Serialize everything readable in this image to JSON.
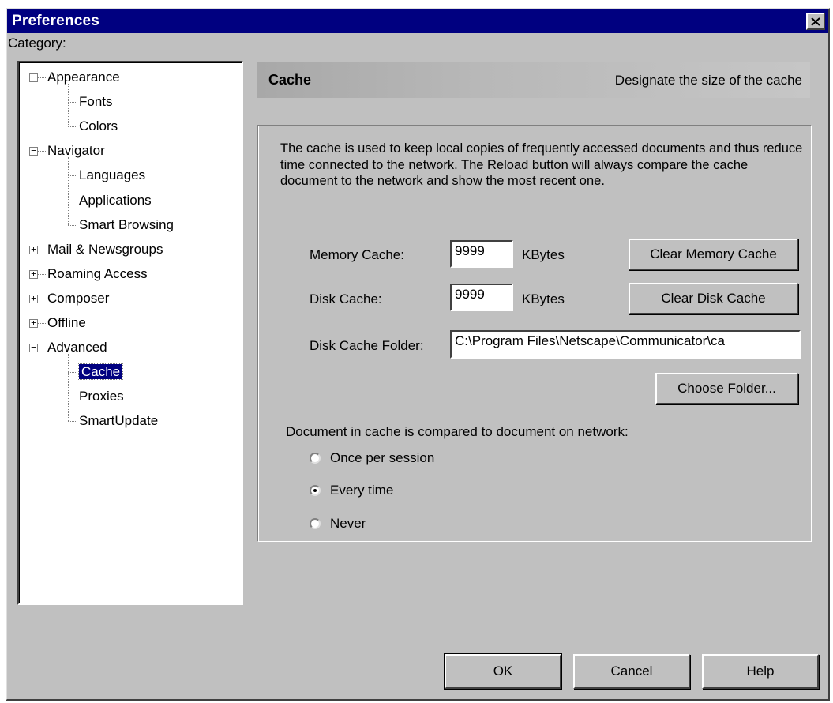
{
  "window": {
    "title": "Preferences"
  },
  "category_label": "Category:",
  "tree": [
    {
      "label": "Appearance",
      "level": 0,
      "expander": "minus"
    },
    {
      "label": "Fonts",
      "level": 1
    },
    {
      "label": "Colors",
      "level": 1
    },
    {
      "label": "Navigator",
      "level": 0,
      "expander": "minus"
    },
    {
      "label": "Languages",
      "level": 1
    },
    {
      "label": "Applications",
      "level": 1
    },
    {
      "label": "Smart Browsing",
      "level": 1
    },
    {
      "label": "Mail & Newsgroups",
      "level": 0,
      "expander": "plus"
    },
    {
      "label": "Roaming Access",
      "level": 0,
      "expander": "plus"
    },
    {
      "label": "Composer",
      "level": 0,
      "expander": "plus"
    },
    {
      "label": "Offline",
      "level": 0,
      "expander": "plus"
    },
    {
      "label": "Advanced",
      "level": 0,
      "expander": "minus"
    },
    {
      "label": "Cache",
      "level": 1,
      "selected": true
    },
    {
      "label": "Proxies",
      "level": 1
    },
    {
      "label": "SmartUpdate",
      "level": 1
    }
  ],
  "panel": {
    "title": "Cache",
    "description": "Designate the size of the cache",
    "body_text": "The cache is used to keep local copies of frequently accessed documents and thus reduce time connected to the network. The Reload button will always compare the cache document to the network and show the most recent one.",
    "memory_cache": {
      "label": "Memory Cache:",
      "value": "9999",
      "unit": "KBytes",
      "button": "Clear Memory Cache"
    },
    "disk_cache": {
      "label": "Disk Cache:",
      "value": "9999",
      "unit": "KBytes",
      "button": "Clear Disk Cache"
    },
    "disk_cache_folder": {
      "label": "Disk Cache Folder:",
      "value": "C:\\Program Files\\Netscape\\Communicator\\ca",
      "button": "Choose Folder..."
    },
    "compare_label": "Document in cache is compared to document on network:",
    "compare_options": [
      {
        "label": "Once per session",
        "checked": false
      },
      {
        "label": "Every time",
        "checked": true
      },
      {
        "label": "Never",
        "checked": false
      }
    ]
  },
  "buttons": {
    "ok": "OK",
    "cancel": "Cancel",
    "help": "Help"
  }
}
